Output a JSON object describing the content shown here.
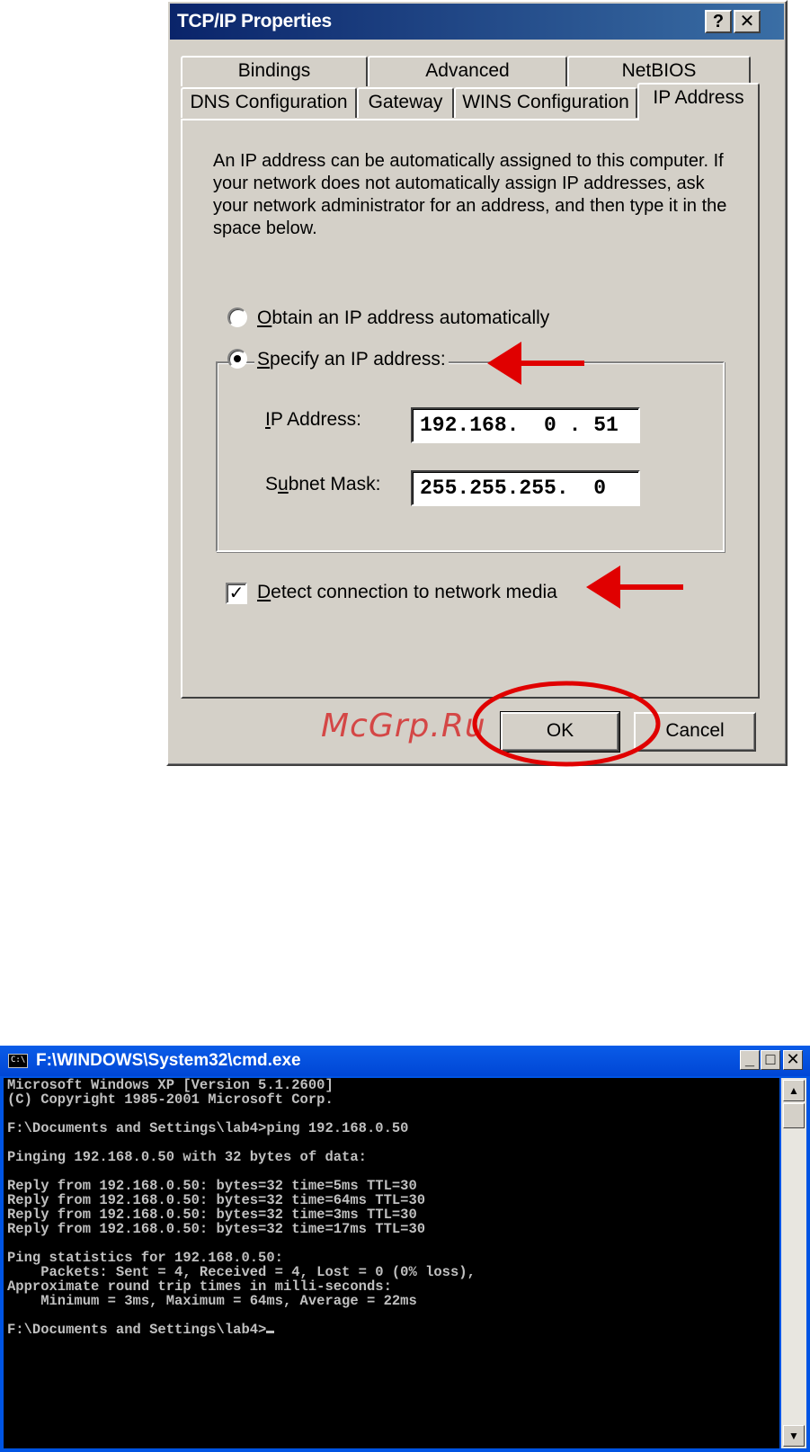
{
  "dialog": {
    "title": "TCP/IP Properties",
    "help_button": "?",
    "close_button": "✕",
    "tabs_back": [
      "Bindings",
      "Advanced",
      "NetBIOS"
    ],
    "tabs_front": [
      "DNS Configuration",
      "Gateway",
      "WINS Configuration",
      "IP Address"
    ],
    "active_tab": "IP Address",
    "description": "An IP address can be automatically assigned to this computer. If your network does not automatically assign IP addresses, ask your network administrator for an address, and then type it in the space below.",
    "radio_obtain_prefix": "O",
    "radio_obtain_rest": "btain an IP address automatically",
    "radio_specify_prefix": "S",
    "radio_specify_rest": "pecify an IP address:",
    "ip_label_prefix": "I",
    "ip_label_rest": "P Address:",
    "ip_value": "192.168.  0 . 51",
    "mask_label_a": "S",
    "mask_label_u": "u",
    "mask_label_rest": "bnet Mask:",
    "mask_value": "255.255.255.  0",
    "detect_prefix": "D",
    "detect_rest": "etect connection to network media",
    "ok_label": "OK",
    "cancel_label": "Cancel"
  },
  "watermark": "McGrp.Ru",
  "annotation_color": "#e00000",
  "cmd": {
    "title": "F:\\WINDOWS\\System32\\cmd.exe",
    "icon_text": "C:\\",
    "min_button": "_",
    "max_button": "□",
    "close_button": "✕",
    "lines": [
      "Microsoft Windows XP [Version 5.1.2600]",
      "(C) Copyright 1985-2001 Microsoft Corp.",
      "",
      "F:\\Documents and Settings\\lab4>ping 192.168.0.50",
      "",
      "Pinging 192.168.0.50 with 32 bytes of data:",
      "",
      "Reply from 192.168.0.50: bytes=32 time=5ms TTL=30",
      "Reply from 192.168.0.50: bytes=32 time=64ms TTL=30",
      "Reply from 192.168.0.50: bytes=32 time=3ms TTL=30",
      "Reply from 192.168.0.50: bytes=32 time=17ms TTL=30",
      "",
      "Ping statistics for 192.168.0.50:",
      "    Packets: Sent = 4, Received = 4, Lost = 0 (0% loss),",
      "Approximate round trip times in milli-seconds:",
      "    Minimum = 3ms, Maximum = 64ms, Average = 22ms",
      ""
    ],
    "prompt": "F:\\Documents and Settings\\lab4>"
  }
}
